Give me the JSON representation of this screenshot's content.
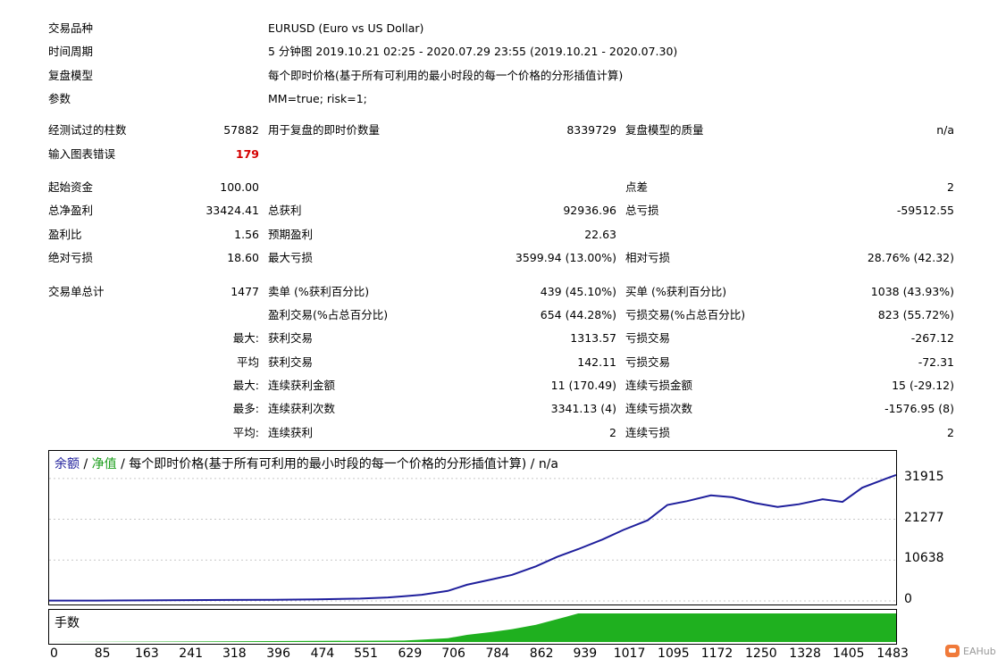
{
  "report": {
    "rows_top": [
      {
        "label": "交易品种",
        "value": "EURUSD (Euro vs US Dollar)"
      },
      {
        "label": "时间周期",
        "value": "5 分钟图 2019.10.21 02:25 - 2020.07.29 23:55 (2019.10.21 - 2020.07.30)"
      },
      {
        "label": "复盘模型",
        "value": "每个即时价格(基于所有可利用的最小时段的每一个价格的分形插值计算)"
      },
      {
        "label": "参数",
        "value": "MM=true; risk=1;"
      }
    ],
    "bars_tested_label": "经测试过的柱数",
    "bars_tested": "57882",
    "ticks_label": "用于复盘的即时价数量",
    "ticks": "8339729",
    "quality_label": "复盘模型的质量",
    "quality": "n/a",
    "errors_label": "输入图表错误",
    "errors": "179",
    "deposit_label": "起始资金",
    "deposit": "100.00",
    "spread_label": "点差",
    "spread": "2",
    "net_profit_label": "总净盈利",
    "net_profit": "33424.41",
    "gross_profit_label": "总获利",
    "gross_profit": "92936.96",
    "gross_loss_label": "总亏损",
    "gross_loss": "-59512.55",
    "profit_factor_label": "盈利比",
    "profit_factor": "1.56",
    "expected_payoff_label": "预期盈利",
    "expected_payoff": "22.63",
    "abs_dd_label": "绝对亏损",
    "abs_dd": "18.60",
    "max_dd_label": "最大亏损",
    "max_dd": "3599.94 (13.00%)",
    "rel_dd_label": "相对亏损",
    "rel_dd": "28.76% (42.32)",
    "total_trades_label": "交易单总计",
    "total_trades": "1477",
    "short_label": "卖单 (%获利百分比)",
    "short": "439 (45.10%)",
    "long_label": "买单 (%获利百分比)",
    "long": "1038 (43.93%)",
    "profit_trades_label": "盈利交易(%占总百分比)",
    "profit_trades": "654 (44.28%)",
    "loss_trades_label": "亏损交易(%占总百分比)",
    "loss_trades": "823 (55.72%)",
    "max_label": "最大:",
    "largest_profit_label": "获利交易",
    "largest_profit": "1313.57",
    "largest_loss_label": "亏损交易",
    "largest_loss": "-267.12",
    "avg_label": "平均",
    "avg_profit_label": "获利交易",
    "avg_profit": "142.11",
    "avg_loss_label": "亏损交易",
    "avg_loss": "-72.31",
    "max2_label": "最大:",
    "max_consec_wins_amt_label": "连续获利金额",
    "max_consec_wins_amt": "11 (170.49)",
    "max_consec_loss_amt_label": "连续亏损金额",
    "max_consec_loss_amt": "15 (-29.12)",
    "most_label": "最多:",
    "max_consec_profit_label": "连续获利次数",
    "max_consec_profit": "3341.13 (4)",
    "max_consec_loss_label": "连续亏损次数",
    "max_consec_loss": "-1576.95 (8)",
    "avg2_label": "平均:",
    "avg_consec_wins_label": "连续获利",
    "avg_consec_wins": "2",
    "avg_consec_losses_label": "连续亏损",
    "avg_consec_losses": "2"
  },
  "chart_header": {
    "balance": "余额",
    "sep1": " / ",
    "equity": "净值",
    "sep2": " / ",
    "model": "每个即时价格(基于所有可利用的最小时段的每一个价格的分形插值计算)",
    "sep3": " / ",
    "quality": "n/a"
  },
  "lots_label": "手数",
  "watermark": "EAHub",
  "colors": {
    "balance": "#1f1f9c",
    "equity": "#1a9d1a",
    "lots": "#1fb01f"
  },
  "chart_data": [
    {
      "type": "line",
      "series": [
        {
          "name": "余额",
          "x": [
            0,
            85,
            163,
            241,
            318,
            396,
            474,
            551,
            600,
            629,
            660,
            706,
            740,
            784,
            820,
            862,
            900,
            937,
            980,
            1017,
            1060,
            1095,
            1130,
            1172,
            1210,
            1250,
            1290,
            1328,
            1370,
            1405,
            1440,
            1483,
            1500
          ],
          "values": [
            100,
            100,
            150,
            200,
            250,
            300,
            400,
            600,
            900,
            1200,
            1600,
            2600,
            4200,
            5600,
            6800,
            9000,
            11500,
            13500,
            16000,
            18500,
            21000,
            25000,
            26000,
            27500,
            27000,
            25500,
            24500,
            25200,
            26500,
            25800,
            29500,
            31915,
            32800
          ]
        }
      ],
      "yticks": [
        "31915",
        "21277",
        "10638",
        "0"
      ],
      "ylim": [
        0,
        33500
      ],
      "xticks": [
        "0",
        "85",
        "163",
        "241",
        "318",
        "396",
        "474",
        "551",
        "629",
        "706",
        "784",
        "862",
        "939",
        "1017",
        "1095",
        "1172",
        "1250",
        "1328",
        "1405",
        "1483"
      ],
      "xlim": [
        0,
        1500
      ]
    },
    {
      "type": "area",
      "series": [
        {
          "name": "手数",
          "x": [
            0,
            629,
            660,
            706,
            740,
            784,
            820,
            862,
            900,
            937,
            1500
          ],
          "values": [
            0,
            0.05,
            0.08,
            0.13,
            0.25,
            0.35,
            0.45,
            0.6,
            0.8,
            1,
            1
          ]
        }
      ],
      "xlim": [
        0,
        1500
      ],
      "ylim": [
        0,
        1
      ]
    }
  ]
}
